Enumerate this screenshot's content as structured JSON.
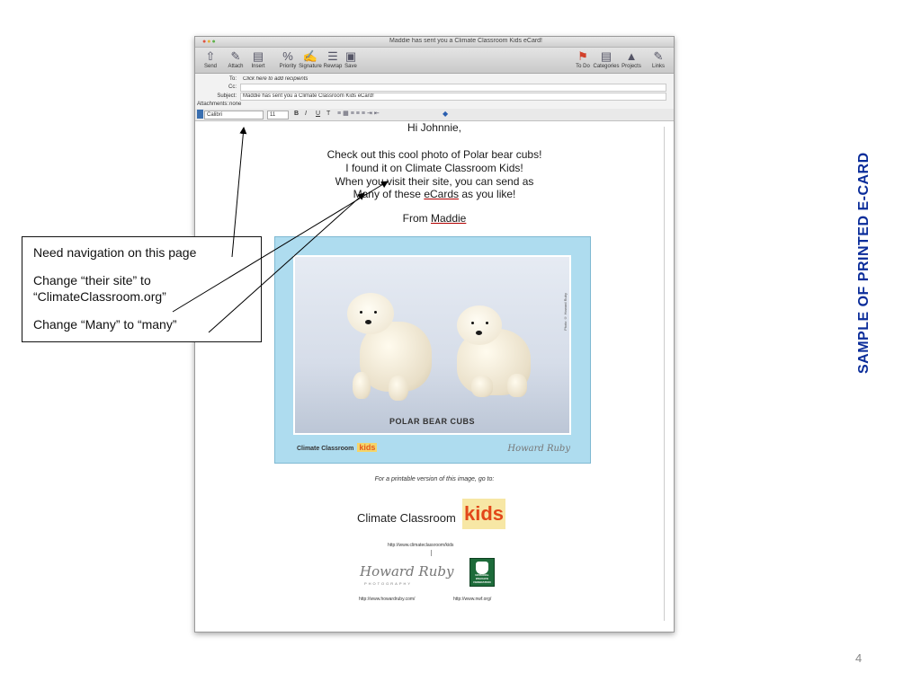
{
  "window": {
    "title": "Maddie has sent you a Climate Classroom Kids eCard!",
    "toolbar_left": [
      {
        "label": "Send",
        "icon": "send-icon",
        "glyph": "⇧"
      },
      {
        "label": "Attach",
        "icon": "paperclip-icon",
        "glyph": "✉"
      },
      {
        "label": "Insert",
        "icon": "insert-icon",
        "glyph": "▤"
      },
      {
        "label": "Priority",
        "icon": "priority-icon",
        "glyph": "%"
      },
      {
        "label": "Signature",
        "icon": "signature-icon",
        "glyph": "✍"
      },
      {
        "label": "Rewrap",
        "icon": "rewrap-icon",
        "glyph": "☰"
      },
      {
        "label": "Save",
        "icon": "save-icon",
        "glyph": "▣"
      }
    ],
    "toolbar_right": [
      {
        "label": "To Do",
        "icon": "flag-icon",
        "glyph": "⚑"
      },
      {
        "label": "Categories",
        "icon": "categories-icon",
        "glyph": "▤"
      },
      {
        "label": "Projects",
        "icon": "projects-icon",
        "glyph": "▲"
      },
      {
        "label": "Links",
        "icon": "links-icon",
        "glyph": "✎"
      }
    ]
  },
  "header": {
    "to_label": "To:",
    "to_placeholder": "Click here to add recipients",
    "cc_label": "Cc:",
    "subject_label": "Subject:",
    "subject_value": "Maddie has sent you a Climate Classroom Kids eCard!",
    "attachments_label": "Attachments:",
    "attachments_value": "none"
  },
  "format_bar": {
    "font": "Calibri",
    "size": "11",
    "buttons": [
      "B",
      "I",
      "U",
      "T"
    ]
  },
  "message": {
    "greeting": "Hi Johnnie,",
    "line1": "Check out this cool photo of Polar bear cubs!",
    "line2": "I found it on Climate Classroom Kids!",
    "line3": "When you visit their site, you can send as",
    "line4_a": "Many of these ",
    "line4_link": "eCards",
    "line4_b": " as you like!",
    "from_prefix": "From ",
    "from_name": "Maddie"
  },
  "ecard": {
    "caption": "POLAR BEAR CUBS",
    "credit": "Photo © Howard Ruby",
    "brand": "Climate Classroom",
    "brand_kids": "kids",
    "signature": "Howard Ruby"
  },
  "footer": {
    "printable": "For a printable version of this image, go to:",
    "cc_logo": "Climate Classroom",
    "cc_kids": "kids",
    "cc_url": "http://www.climateclassroom/kids",
    "hr_signature": "Howard Ruby",
    "hr_sub": "PHOTOGRAPHY",
    "hr_url": "http://www.howardruby.com/",
    "nwf_label": "NATIONAL WILDLIFE FEDERATION",
    "nwf_url": "http://www.nwf.org/"
  },
  "annotation": {
    "line1": "Need navigation on this page",
    "line2a": "Change “their site” to",
    "line2b": "“ClimateClassroom.org”",
    "line3": "Change “Many” to “many”"
  },
  "slide": {
    "side_title": "SAMPLE OF PRINTED E-CARD",
    "page_number": "4"
  },
  "colors": {
    "side_title": "#0b2d9a",
    "ecard_background": "#aedcef",
    "kids_orange": "#e2471a"
  }
}
